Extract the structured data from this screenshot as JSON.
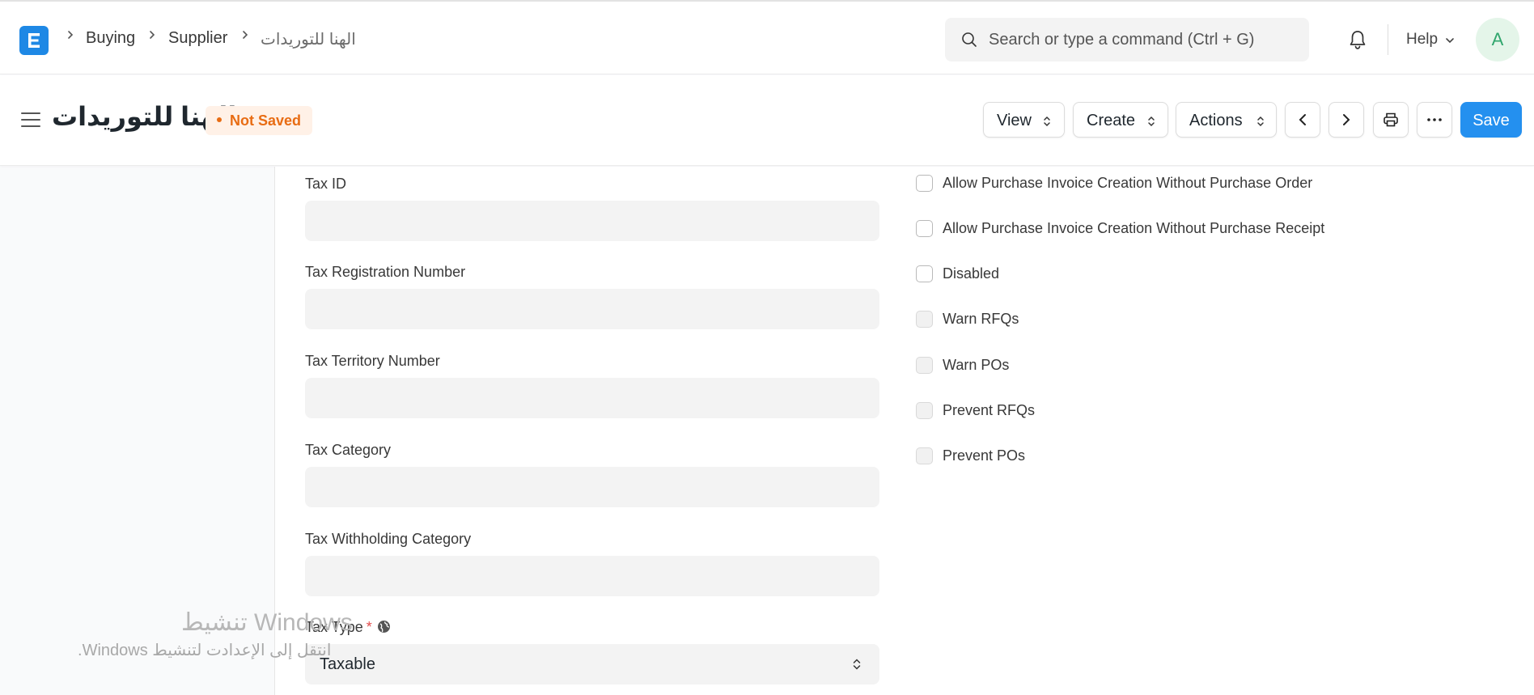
{
  "navbar": {
    "logo_letter": "E",
    "breadcrumbs": [
      "Buying",
      "Supplier",
      "الهنا للتوريدات"
    ],
    "search_placeholder": "Search or type a command (Ctrl + G)",
    "help_label": "Help",
    "avatar_initial": "A"
  },
  "page": {
    "title": "الهنا للتوريدات",
    "status": "Not Saved",
    "buttons": {
      "view": "View",
      "create": "Create",
      "actions": "Actions",
      "save": "Save"
    }
  },
  "form": {
    "left_fields": [
      {
        "label": "Tax ID",
        "value": ""
      },
      {
        "label": "Tax Registration Number",
        "value": ""
      },
      {
        "label": "Tax Territory Number",
        "value": ""
      },
      {
        "label": "Tax Category",
        "value": ""
      },
      {
        "label": "Tax Withholding Category",
        "value": ""
      }
    ],
    "tax_type": {
      "label": "Tax Type",
      "required_mark": "*",
      "value": "Taxable"
    },
    "checkboxes": [
      {
        "label": "Allow Purchase Invoice Creation Without Purchase Order",
        "checked": false
      },
      {
        "label": "Allow Purchase Invoice Creation Without Purchase Receipt",
        "checked": false
      },
      {
        "label": "Disabled",
        "checked": false
      },
      {
        "label": "Warn RFQs",
        "checked": false
      },
      {
        "label": "Warn POs",
        "checked": false
      },
      {
        "label": "Prevent RFQs",
        "checked": false
      },
      {
        "label": "Prevent POs",
        "checked": false
      }
    ]
  },
  "watermark": {
    "title": "تنشيط Windows",
    "subtitle": "انتقل إلى الإعدادت لتنشيط Windows."
  },
  "colors": {
    "primary": "#2490ef",
    "logo": "#1e88e5",
    "not_saved": "#e86c13",
    "avatar_bg": "#e4f5e9",
    "avatar_text": "#30a66d"
  }
}
